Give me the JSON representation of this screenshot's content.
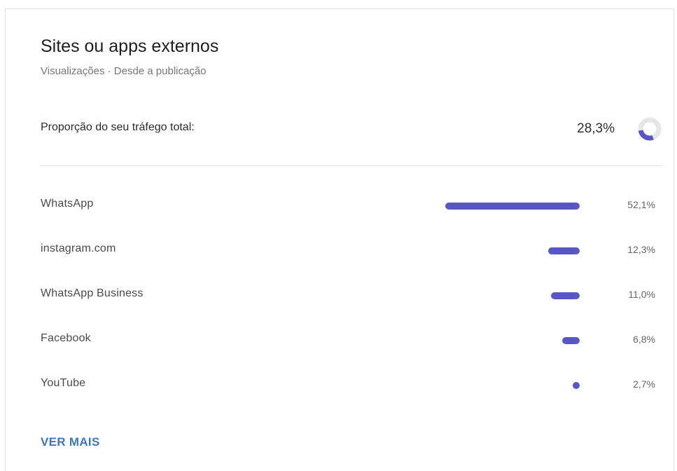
{
  "card": {
    "title": "Sites ou apps externos",
    "subtitle": "Visualizações · Desde a publicação"
  },
  "share": {
    "label": "Proporção do seu tráfego total:",
    "value": "28,3%",
    "fraction": 0.283
  },
  "rows": [
    {
      "label": "WhatsApp",
      "value_text": "52,1%",
      "value": 52.1
    },
    {
      "label": "instagram.com",
      "value_text": "12,3%",
      "value": 12.3
    },
    {
      "label": "WhatsApp Business",
      "value_text": "11,0%",
      "value": 11.0
    },
    {
      "label": "Facebook",
      "value_text": "6,8%",
      "value": 6.8
    },
    {
      "label": "YouTube",
      "value_text": "2,7%",
      "value": 2.7
    }
  ],
  "actions": {
    "see_more": "VER MAIS"
  },
  "colors": {
    "bar": "#5b56c5",
    "donut_track": "#e6e6e6",
    "link": "#3c77b6"
  },
  "icons": {
    "share": "donut-chart-icon"
  }
}
